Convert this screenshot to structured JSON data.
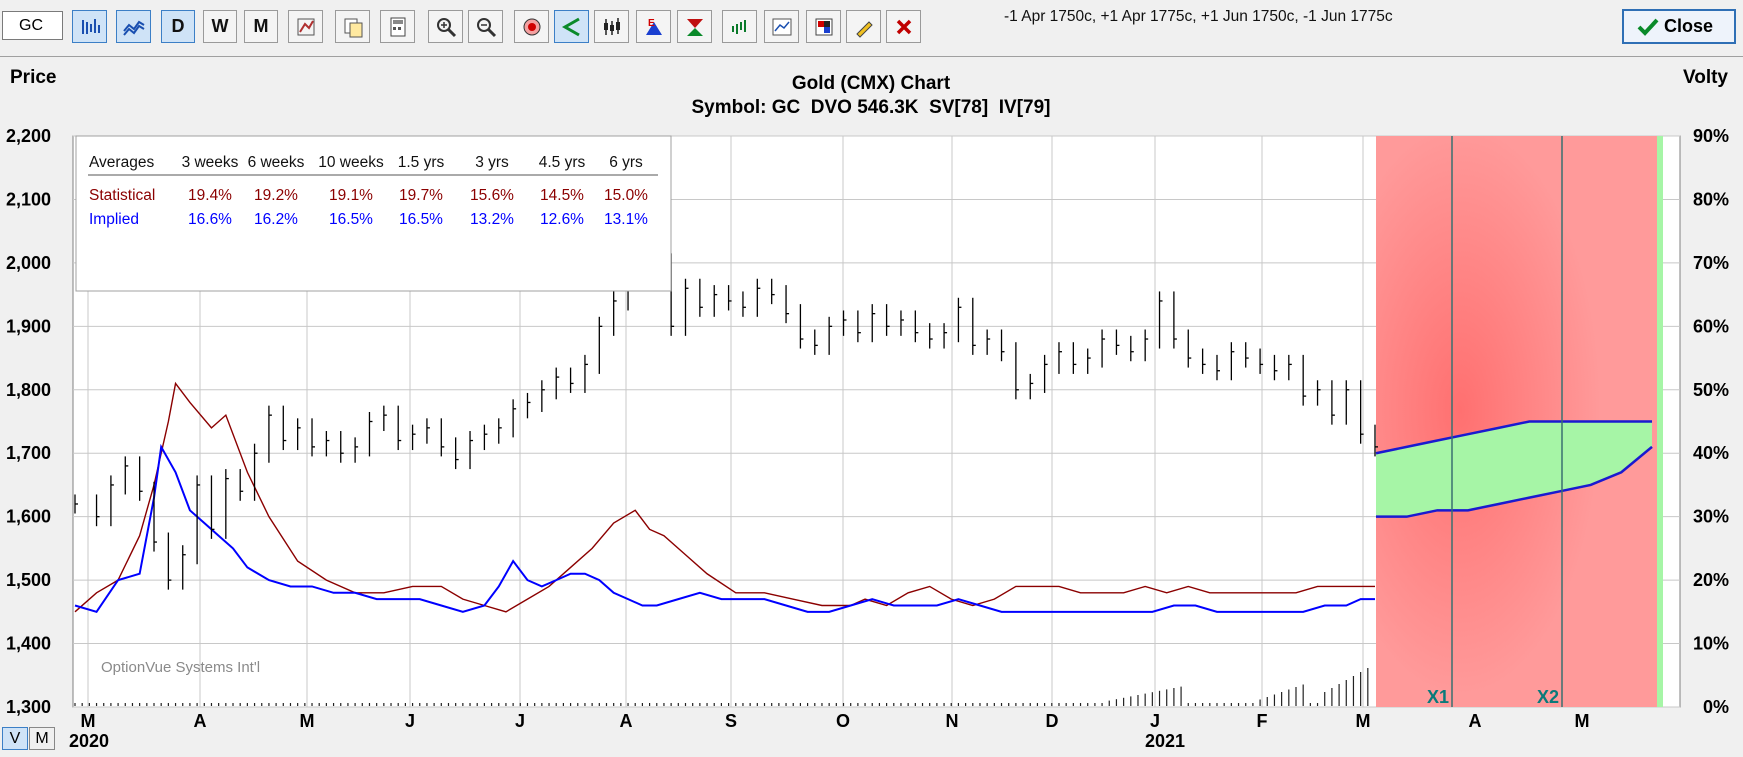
{
  "toolbar": {
    "symbol": "GC",
    "period_buttons": [
      "D",
      "W",
      "M"
    ],
    "strategy": "-1 Apr 1750c, +1 Apr 1775c, +1 Jun 1750c, -1 Jun 1775c",
    "close_label": "Close",
    "icons": [
      "bar-chart-icon",
      "line-chart-icon",
      "chart-settings-icon",
      "copy-icon",
      "calculator-icon",
      "zoom-in-icon",
      "zoom-out-icon",
      "target-icon",
      "cursor-icon",
      "candlestick-icon",
      "earnings-icon",
      "triangle-icon",
      "indicator-icon",
      "study-icon",
      "color-palette-icon",
      "pencil-icon",
      "delete-icon"
    ]
  },
  "colors": {
    "price": "#000000",
    "statistical": "#8b0000",
    "implied": "#0000ff",
    "profit_zone": "#a6f5a6",
    "loss_zone": "#ff9a9a",
    "expiration_line": "#3a7070"
  },
  "chart_data": {
    "type": "line",
    "title": "Gold (CMX) Chart",
    "subtitle": "Symbol: GC  DVO 546.3K  SV[78]  IV[79]",
    "left_axis_label": "Price",
    "right_axis_label": "Volty",
    "ylim": [
      1300,
      2200
    ],
    "y_ticks": [
      "1,300",
      "1,400",
      "1,500",
      "1,600",
      "1,700",
      "1,800",
      "1,900",
      "2,000",
      "2,100",
      "2,200"
    ],
    "y2lim": [
      0,
      90
    ],
    "y2_ticks": [
      "0%",
      "10%",
      "20%",
      "30%",
      "40%",
      "50%",
      "60%",
      "70%",
      "80%",
      "90%"
    ],
    "x_month_labels": [
      "M",
      "A",
      "M",
      "J",
      "J",
      "A",
      "S",
      "O",
      "N",
      "D",
      "J",
      "F",
      "M",
      "A",
      "M"
    ],
    "x_year_labels": [
      "2020",
      "2021"
    ],
    "grid": true,
    "watermark": "OptionVue Systems Int'l",
    "averages_table": {
      "header": [
        "Averages",
        "3 weeks",
        "6 weeks",
        "10 weeks",
        "1.5 yrs",
        "3 yrs",
        "4.5 yrs",
        "6 yrs"
      ],
      "rows": [
        {
          "label": "Statistical",
          "values": [
            "19.4%",
            "19.2%",
            "19.1%",
            "19.7%",
            "15.6%",
            "14.5%",
            "15.0%"
          ]
        },
        {
          "label": "Implied",
          "values": [
            "16.6%",
            "16.2%",
            "16.5%",
            "16.5%",
            "13.2%",
            "12.6%",
            "13.1%"
          ]
        }
      ]
    },
    "price_series": {
      "name": "Price",
      "points": [
        [
          0,
          1620
        ],
        [
          3,
          1600
        ],
        [
          5,
          1650
        ],
        [
          7,
          1680
        ],
        [
          9,
          1640
        ],
        [
          11,
          1560
        ],
        [
          13,
          1500
        ],
        [
          15,
          1540
        ],
        [
          17,
          1650
        ],
        [
          19,
          1580
        ],
        [
          21,
          1660
        ],
        [
          23,
          1640
        ],
        [
          25,
          1700
        ],
        [
          27,
          1760
        ],
        [
          29,
          1720
        ],
        [
          31,
          1740
        ],
        [
          33,
          1710
        ],
        [
          35,
          1720
        ],
        [
          37,
          1700
        ],
        [
          39,
          1710
        ],
        [
          41,
          1750
        ],
        [
          43,
          1760
        ],
        [
          45,
          1720
        ],
        [
          47,
          1730
        ],
        [
          49,
          1740
        ],
        [
          51,
          1710
        ],
        [
          53,
          1690
        ],
        [
          55,
          1720
        ],
        [
          57,
          1730
        ],
        [
          59,
          1740
        ],
        [
          61,
          1770
        ],
        [
          63,
          1780
        ],
        [
          65,
          1800
        ],
        [
          67,
          1820
        ],
        [
          69,
          1810
        ],
        [
          71,
          1840
        ],
        [
          73,
          1900
        ],
        [
          75,
          1940
        ],
        [
          77,
          1970
        ],
        [
          79,
          2030
        ],
        [
          81,
          2000
        ],
        [
          83,
          1900
        ],
        [
          85,
          1960
        ],
        [
          87,
          1930
        ],
        [
          89,
          1950
        ],
        [
          91,
          1940
        ],
        [
          93,
          1930
        ],
        [
          95,
          1960
        ],
        [
          97,
          1950
        ],
        [
          99,
          1920
        ],
        [
          101,
          1880
        ],
        [
          103,
          1870
        ],
        [
          105,
          1900
        ],
        [
          107,
          1910
        ],
        [
          109,
          1890
        ],
        [
          111,
          1920
        ],
        [
          113,
          1900
        ],
        [
          115,
          1910
        ],
        [
          117,
          1890
        ],
        [
          119,
          1880
        ],
        [
          121,
          1890
        ],
        [
          123,
          1930
        ],
        [
          125,
          1870
        ],
        [
          127,
          1880
        ],
        [
          129,
          1860
        ],
        [
          131,
          1800
        ],
        [
          133,
          1810
        ],
        [
          135,
          1840
        ],
        [
          137,
          1860
        ],
        [
          139,
          1840
        ],
        [
          141,
          1850
        ],
        [
          143,
          1880
        ],
        [
          145,
          1870
        ],
        [
          147,
          1860
        ],
        [
          149,
          1880
        ],
        [
          151,
          1940
        ],
        [
          153,
          1880
        ],
        [
          155,
          1850
        ],
        [
          157,
          1840
        ],
        [
          159,
          1830
        ],
        [
          161,
          1860
        ],
        [
          163,
          1850
        ],
        [
          165,
          1840
        ],
        [
          167,
          1830
        ],
        [
          169,
          1840
        ],
        [
          171,
          1790
        ],
        [
          173,
          1800
        ],
        [
          175,
          1760
        ],
        [
          177,
          1800
        ],
        [
          179,
          1730
        ],
        [
          181,
          1710
        ]
      ]
    },
    "statistical_series": {
      "name": "Statistical",
      "points": [
        [
          0,
          15
        ],
        [
          3,
          18
        ],
        [
          6,
          20
        ],
        [
          9,
          27
        ],
        [
          11,
          35
        ],
        [
          13,
          45
        ],
        [
          14,
          51
        ],
        [
          16,
          48
        ],
        [
          19,
          44
        ],
        [
          21,
          46
        ],
        [
          24,
          37
        ],
        [
          27,
          30
        ],
        [
          31,
          23
        ],
        [
          35,
          20
        ],
        [
          39,
          18
        ],
        [
          43,
          18
        ],
        [
          47,
          19
        ],
        [
          51,
          19
        ],
        [
          54,
          17
        ],
        [
          57,
          16
        ],
        [
          60,
          15
        ],
        [
          63,
          17
        ],
        [
          66,
          19
        ],
        [
          69,
          22
        ],
        [
          72,
          25
        ],
        [
          75,
          29
        ],
        [
          78,
          31
        ],
        [
          80,
          28
        ],
        [
          82,
          27
        ],
        [
          85,
          24
        ],
        [
          88,
          21
        ],
        [
          92,
          18
        ],
        [
          96,
          18
        ],
        [
          100,
          17
        ],
        [
          104,
          16
        ],
        [
          108,
          16
        ],
        [
          110,
          17
        ],
        [
          113,
          16
        ],
        [
          116,
          18
        ],
        [
          119,
          19
        ],
        [
          122,
          17
        ],
        [
          125,
          16
        ],
        [
          128,
          17
        ],
        [
          131,
          19
        ],
        [
          134,
          19
        ],
        [
          137,
          19
        ],
        [
          140,
          18
        ],
        [
          143,
          18
        ],
        [
          146,
          18
        ],
        [
          149,
          19
        ],
        [
          152,
          18
        ],
        [
          155,
          19
        ],
        [
          158,
          18
        ],
        [
          161,
          18
        ],
        [
          164,
          18
        ],
        [
          167,
          18
        ],
        [
          170,
          18
        ],
        [
          173,
          19
        ],
        [
          176,
          19
        ],
        [
          179,
          19
        ],
        [
          181,
          19
        ]
      ]
    },
    "implied_series": {
      "name": "Implied",
      "points": [
        [
          0,
          16
        ],
        [
          3,
          15
        ],
        [
          6,
          20
        ],
        [
          9,
          21
        ],
        [
          11,
          33
        ],
        [
          12,
          41
        ],
        [
          14,
          37
        ],
        [
          16,
          31
        ],
        [
          18,
          29
        ],
        [
          20,
          27
        ],
        [
          22,
          25
        ],
        [
          24,
          22
        ],
        [
          27,
          20
        ],
        [
          30,
          19
        ],
        [
          33,
          19
        ],
        [
          36,
          18
        ],
        [
          39,
          18
        ],
        [
          42,
          17
        ],
        [
          45,
          17
        ],
        [
          48,
          17
        ],
        [
          51,
          16
        ],
        [
          54,
          15
        ],
        [
          57,
          16
        ],
        [
          59,
          19
        ],
        [
          61,
          23
        ],
        [
          63,
          20
        ],
        [
          65,
          19
        ],
        [
          67,
          20
        ],
        [
          69,
          21
        ],
        [
          71,
          21
        ],
        [
          73,
          20
        ],
        [
          75,
          18
        ],
        [
          77,
          17
        ],
        [
          79,
          16
        ],
        [
          81,
          16
        ],
        [
          84,
          17
        ],
        [
          87,
          18
        ],
        [
          90,
          17
        ],
        [
          93,
          17
        ],
        [
          96,
          17
        ],
        [
          99,
          16
        ],
        [
          102,
          15
        ],
        [
          105,
          15
        ],
        [
          108,
          16
        ],
        [
          111,
          17
        ],
        [
          114,
          16
        ],
        [
          117,
          16
        ],
        [
          120,
          16
        ],
        [
          123,
          17
        ],
        [
          126,
          16
        ],
        [
          129,
          15
        ],
        [
          132,
          15
        ],
        [
          135,
          15
        ],
        [
          138,
          15
        ],
        [
          141,
          15
        ],
        [
          144,
          15
        ],
        [
          147,
          15
        ],
        [
          150,
          15
        ],
        [
          153,
          16
        ],
        [
          156,
          16
        ],
        [
          159,
          15
        ],
        [
          162,
          15
        ],
        [
          165,
          15
        ],
        [
          168,
          15
        ],
        [
          171,
          15
        ],
        [
          174,
          16
        ],
        [
          177,
          16
        ],
        [
          179,
          17
        ],
        [
          181,
          17
        ]
      ]
    },
    "analysis": {
      "expiration_labels": [
        "X1",
        "X2"
      ],
      "upper_bound_volty": [
        40,
        41,
        42,
        43,
        44,
        45,
        45,
        45,
        45,
        45
      ],
      "lower_bound_volty": [
        30,
        30,
        31,
        31,
        32,
        33,
        34,
        35,
        37,
        41
      ]
    }
  },
  "bottom": {
    "v_label": "V",
    "m_label": "M"
  }
}
